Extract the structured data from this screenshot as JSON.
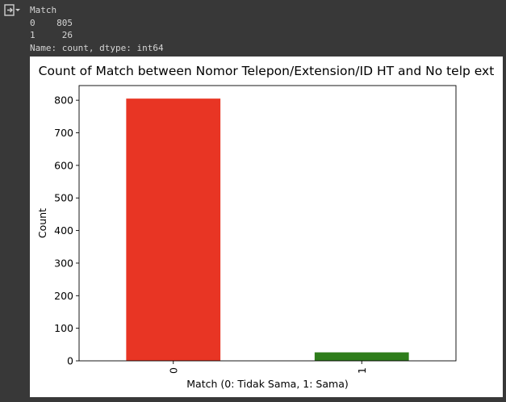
{
  "output": {
    "lines": [
      "Match",
      "0    805",
      "1     26",
      "Name: count, dtype: int64"
    ]
  },
  "chart_data": {
    "type": "bar",
    "title": "Count of Match between Nomor Telepon/Extension/ID HT and No telp ext",
    "xlabel": "Match (0: Tidak Sama, 1: Sama)",
    "ylabel": "Count",
    "categories": [
      "0",
      "1"
    ],
    "values": [
      805,
      26
    ],
    "colors": [
      "#e83524",
      "#2e7d1b"
    ],
    "ylim": [
      0,
      845
    ],
    "yticks": [
      0,
      100,
      200,
      300,
      400,
      500,
      600,
      700,
      800
    ],
    "grid": false,
    "legend": "none"
  }
}
